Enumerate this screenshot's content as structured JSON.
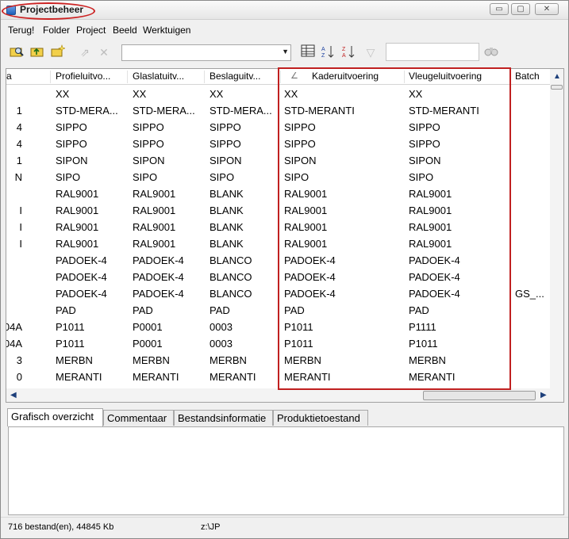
{
  "window": {
    "title": "Projectbeheer",
    "min_glyph": "▭",
    "max_glyph": "▢",
    "close_glyph": "✕"
  },
  "menu": [
    "Terug!",
    "Folder",
    "Project",
    "Beeld",
    "Werktuigen"
  ],
  "toolbar": {
    "combo_value": "",
    "search_value": "",
    "icons": [
      "search-folder-icon",
      "folder-up-icon",
      "new-folder-icon",
      "move-icon",
      "delete-icon",
      "columns-icon",
      "sort-ascending-icon",
      "sort-descending-icon",
      "filter-icon",
      "binoculars-icon"
    ]
  },
  "grid": {
    "columns": [
      "a",
      "Profieluitvo...",
      "Glaslatuitv...",
      "Beslaguitv...",
      "Kaderuitvoering",
      "Vleugeluitvoering",
      "Batch"
    ],
    "sort_glyph": "∠",
    "rows": [
      [
        "",
        "XX",
        "XX",
        "XX",
        "XX",
        "XX",
        ""
      ],
      [
        "1",
        "STD-MERA...",
        "STD-MERA...",
        "STD-MERA...",
        "STD-MERANTI",
        "STD-MERANTI",
        ""
      ],
      [
        "4",
        "SIPPO",
        "SIPPO",
        "SIPPO",
        "SIPPO",
        "SIPPO",
        ""
      ],
      [
        "4",
        "SIPPO",
        "SIPPO",
        "SIPPO",
        "SIPPO",
        "SIPPO",
        ""
      ],
      [
        "1",
        "SIPON",
        "SIPON",
        "SIPON",
        "SIPON",
        "SIPON",
        ""
      ],
      [
        "N",
        "SIPO",
        "SIPO",
        "SIPO",
        "SIPO",
        "SIPO",
        ""
      ],
      [
        "",
        "RAL9001",
        "RAL9001",
        "BLANK",
        "RAL9001",
        "RAL9001",
        ""
      ],
      [
        "I",
        "RAL9001",
        "RAL9001",
        "BLANK",
        "RAL9001",
        "RAL9001",
        ""
      ],
      [
        "I",
        "RAL9001",
        "RAL9001",
        "BLANK",
        "RAL9001",
        "RAL9001",
        ""
      ],
      [
        "I",
        "RAL9001",
        "RAL9001",
        "BLANK",
        "RAL9001",
        "RAL9001",
        ""
      ],
      [
        "",
        "PADOEK-4",
        "PADOEK-4",
        "BLANCO",
        "PADOEK-4",
        "PADOEK-4",
        ""
      ],
      [
        "",
        "PADOEK-4",
        "PADOEK-4",
        "BLANCO",
        "PADOEK-4",
        "PADOEK-4",
        ""
      ],
      [
        "",
        "PADOEK-4",
        "PADOEK-4",
        "BLANCO",
        "PADOEK-4",
        "PADOEK-4",
        "GS_..."
      ],
      [
        "",
        "PAD",
        "PAD",
        "PAD",
        "PAD",
        "PAD",
        ""
      ],
      [
        "04A",
        "P1011",
        "P0001",
        "0003",
        "P1011",
        "P1111",
        ""
      ],
      [
        "04A",
        "P1011",
        "P0001",
        "0003",
        "P1011",
        "P1011",
        ""
      ],
      [
        "3",
        "MERBN",
        "MERBN",
        "MERBN",
        "MERBN",
        "MERBN",
        ""
      ],
      [
        "0",
        "MERANTI",
        "MERANTI",
        "MERANTI",
        "MERANTI",
        "MERANTI",
        ""
      ]
    ]
  },
  "tabs": [
    "Grafisch overzicht",
    "Commentaar",
    "Bestandsinformatie",
    "Produktietoestand"
  ],
  "status": {
    "files": "716 bestand(en), 44845 Kb",
    "path": "z:\\JP"
  }
}
